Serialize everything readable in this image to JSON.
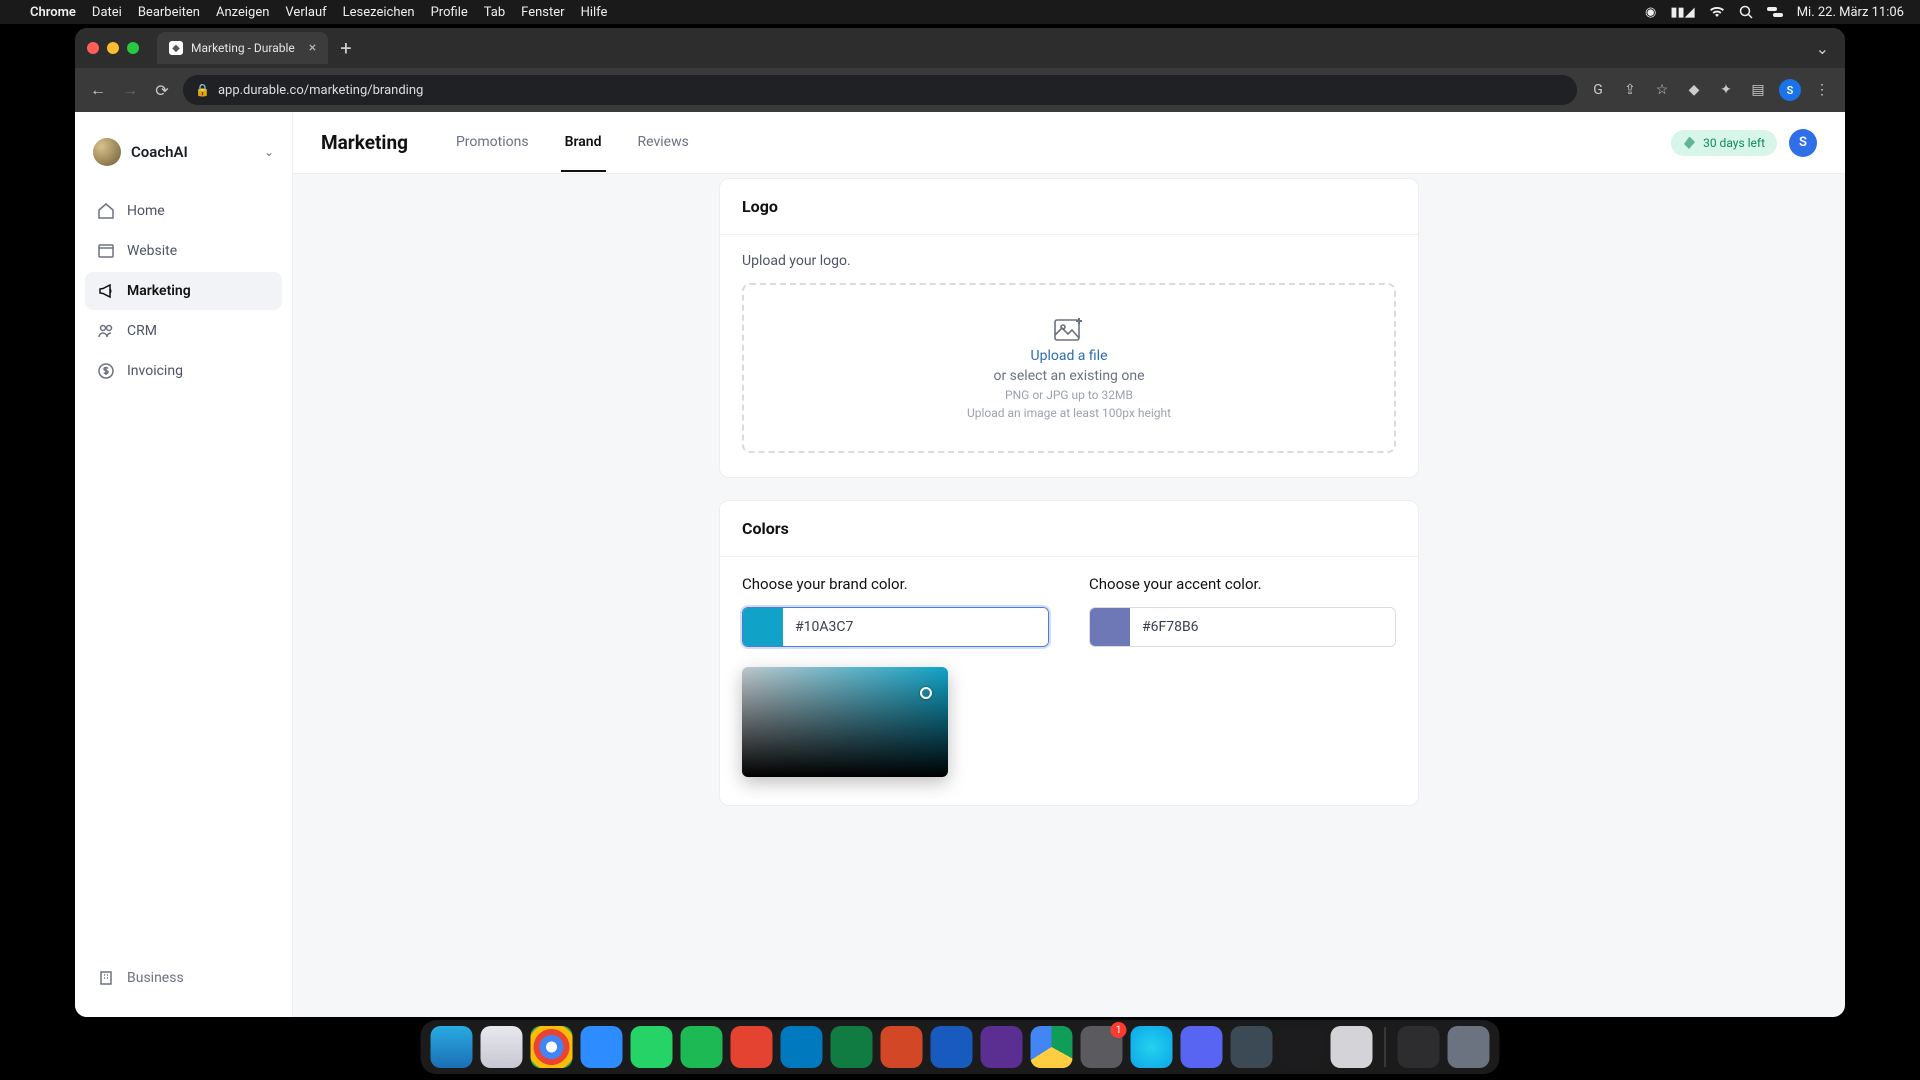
{
  "mac": {
    "app": "Chrome",
    "menu": [
      "Datei",
      "Bearbeiten",
      "Anzeigen",
      "Verlauf",
      "Lesezeichen",
      "Profile",
      "Tab",
      "Fenster",
      "Hilfe"
    ],
    "clock": "Mi. 22. März  11:06"
  },
  "browser": {
    "tab_title": "Marketing - Durable",
    "url": "app.durable.co/marketing/branding",
    "avatar_letter": "S"
  },
  "sidebar": {
    "brand": "CoachAI",
    "items": [
      {
        "icon": "home",
        "label": "Home"
      },
      {
        "icon": "website",
        "label": "Website"
      },
      {
        "icon": "marketing",
        "label": "Marketing"
      },
      {
        "icon": "crm",
        "label": "CRM"
      },
      {
        "icon": "invoicing",
        "label": "Invoicing"
      }
    ],
    "active_index": 2,
    "footer": {
      "icon": "business",
      "label": "Business"
    }
  },
  "topbar": {
    "title": "Marketing",
    "tabs": [
      "Promotions",
      "Brand",
      "Reviews"
    ],
    "active_index": 1,
    "trial_text": "30 days left",
    "avatar_letter": "S"
  },
  "logo_card": {
    "title": "Logo",
    "subtitle": "Upload your logo.",
    "link": "Upload a file",
    "or_text": "or select an existing one",
    "hint1": "PNG or JPG up to 32MB",
    "hint2": "Upload an image at least 100px height"
  },
  "colors_card": {
    "title": "Colors",
    "brand_label": "Choose your brand color.",
    "brand_value": "#10A3C7",
    "accent_label": "Choose your accent color.",
    "accent_value": "#6F78B6"
  },
  "dock": {
    "icons": [
      {
        "name": "finder",
        "bg": "linear-gradient(#29abe2,#1b6fb5)"
      },
      {
        "name": "safari",
        "bg": "linear-gradient(#e8e8ee,#c8c8d4)"
      },
      {
        "name": "chrome",
        "bg": "radial-gradient(circle at 50% 50%, #fff 18%, #4285f4 19% 40%, #ea4335 41% 60%, #fbbc05 61% 80%, #34a853 81%)"
      },
      {
        "name": "zoom",
        "bg": "#2d8cff"
      },
      {
        "name": "whatsapp",
        "bg": "#25d366"
      },
      {
        "name": "spotify",
        "bg": "#1db954"
      },
      {
        "name": "todoist",
        "bg": "#e44332"
      },
      {
        "name": "trello",
        "bg": "#0079bf"
      },
      {
        "name": "excel",
        "bg": "#107c41"
      },
      {
        "name": "powerpoint",
        "bg": "#d24726"
      },
      {
        "name": "word",
        "bg": "#185abd"
      },
      {
        "name": "imovie",
        "bg": "#5b2e91"
      },
      {
        "name": "drive",
        "bg": "conic-gradient(#0f9d58 0 33%, #ffcd40 33% 66%, #4285f4 66%)"
      },
      {
        "name": "settings",
        "bg": "#5a5a5f",
        "badge": "1"
      },
      {
        "name": "siri",
        "bg": "radial-gradient(circle,#22d3ee,#0ea5e9)"
      },
      {
        "name": "discord",
        "bg": "#5865f2"
      },
      {
        "name": "quicktime",
        "bg": "#3b4a54"
      },
      {
        "name": "voice-memos",
        "bg": "#1c1c1e"
      },
      {
        "name": "automator",
        "bg": "#d4d4d8"
      },
      {
        "name": "launchpad",
        "bg": "#2d2d30"
      },
      {
        "name": "trash",
        "bg": "#6b7280"
      }
    ],
    "sep_after_index": 18
  }
}
